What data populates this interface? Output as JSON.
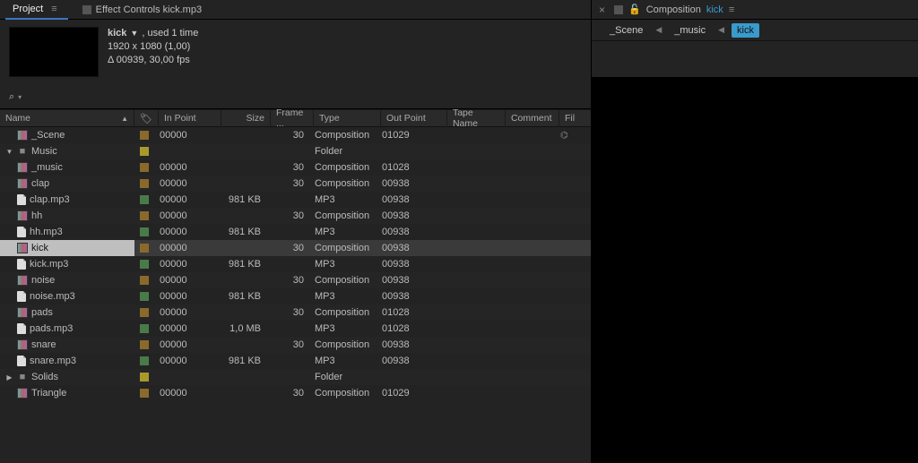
{
  "tabs": {
    "project": "Project",
    "effectControls": "Effect Controls kick.mp3"
  },
  "previewMeta": {
    "name": "kick",
    "used": ", used 1 time",
    "dims": "1920 x 1080 (1,00)",
    "delta": "Δ 00939, 30,00 fps"
  },
  "search": {
    "placeholder": ""
  },
  "columns": {
    "name": "Name",
    "inpoint": "In Point",
    "size": "Size",
    "frame": "Frame ...",
    "type": "Type",
    "outpoint": "Out Point",
    "tape": "Tape Name",
    "comment": "Comment",
    "fil": "Fil"
  },
  "rows": [
    {
      "depth": 0,
      "twisty": "",
      "icon": "comp",
      "name": "_Scene",
      "tagColor": "orange",
      "inpoint": "00000",
      "size": "",
      "frame": "30",
      "type": "Composition",
      "outpoint": "01029",
      "selected": false,
      "flow": true
    },
    {
      "depth": 0,
      "twisty": "▼",
      "icon": "folder",
      "name": "Music",
      "tagColor": "yellow",
      "inpoint": "",
      "size": "",
      "frame": "",
      "type": "Folder",
      "outpoint": "",
      "selected": false
    },
    {
      "depth": 1,
      "twisty": "",
      "icon": "comp",
      "name": "_music",
      "tagColor": "orange",
      "inpoint": "00000",
      "size": "",
      "frame": "30",
      "type": "Composition",
      "outpoint": "01028",
      "selected": false
    },
    {
      "depth": 1,
      "twisty": "",
      "icon": "comp",
      "name": "clap",
      "tagColor": "orange",
      "inpoint": "00000",
      "size": "",
      "frame": "30",
      "type": "Composition",
      "outpoint": "00938",
      "selected": false
    },
    {
      "depth": 1,
      "twisty": "",
      "icon": "file",
      "name": "clap.mp3",
      "tagColor": "green",
      "inpoint": "00000",
      "size": "981 KB",
      "frame": "",
      "type": "MP3",
      "outpoint": "00938",
      "selected": false
    },
    {
      "depth": 1,
      "twisty": "",
      "icon": "comp",
      "name": "hh",
      "tagColor": "orange",
      "inpoint": "00000",
      "size": "",
      "frame": "30",
      "type": "Composition",
      "outpoint": "00938",
      "selected": false
    },
    {
      "depth": 1,
      "twisty": "",
      "icon": "file",
      "name": "hh.mp3",
      "tagColor": "green",
      "inpoint": "00000",
      "size": "981 KB",
      "frame": "",
      "type": "MP3",
      "outpoint": "00938",
      "selected": false
    },
    {
      "depth": 1,
      "twisty": "",
      "icon": "comp",
      "name": "kick",
      "tagColor": "orange",
      "inpoint": "00000",
      "size": "",
      "frame": "30",
      "type": "Composition",
      "outpoint": "00938",
      "selected": true
    },
    {
      "depth": 1,
      "twisty": "",
      "icon": "file",
      "name": "kick.mp3",
      "tagColor": "green",
      "inpoint": "00000",
      "size": "981 KB",
      "frame": "",
      "type": "MP3",
      "outpoint": "00938",
      "selected": false
    },
    {
      "depth": 1,
      "twisty": "",
      "icon": "comp",
      "name": "noise",
      "tagColor": "orange",
      "inpoint": "00000",
      "size": "",
      "frame": "30",
      "type": "Composition",
      "outpoint": "00938",
      "selected": false
    },
    {
      "depth": 1,
      "twisty": "",
      "icon": "file",
      "name": "noise.mp3",
      "tagColor": "green",
      "inpoint": "00000",
      "size": "981 KB",
      "frame": "",
      "type": "MP3",
      "outpoint": "00938",
      "selected": false
    },
    {
      "depth": 1,
      "twisty": "",
      "icon": "comp",
      "name": "pads",
      "tagColor": "orange",
      "inpoint": "00000",
      "size": "",
      "frame": "30",
      "type": "Composition",
      "outpoint": "01028",
      "selected": false
    },
    {
      "depth": 1,
      "twisty": "",
      "icon": "file",
      "name": "pads.mp3",
      "tagColor": "green",
      "inpoint": "00000",
      "size": "1,0 MB",
      "frame": "",
      "type": "MP3",
      "outpoint": "01028",
      "selected": false
    },
    {
      "depth": 1,
      "twisty": "",
      "icon": "comp",
      "name": "snare",
      "tagColor": "orange",
      "inpoint": "00000",
      "size": "",
      "frame": "30",
      "type": "Composition",
      "outpoint": "00938",
      "selected": false
    },
    {
      "depth": 1,
      "twisty": "",
      "icon": "file",
      "name": "snare.mp3",
      "tagColor": "green",
      "inpoint": "00000",
      "size": "981 KB",
      "frame": "",
      "type": "MP3",
      "outpoint": "00938",
      "selected": false
    },
    {
      "depth": 0,
      "twisty": "▶",
      "icon": "folder",
      "name": "Solids",
      "tagColor": "yellow",
      "inpoint": "",
      "size": "",
      "frame": "",
      "type": "Folder",
      "outpoint": "",
      "selected": false
    },
    {
      "depth": 0,
      "twisty": "",
      "icon": "comp",
      "name": "Triangle",
      "tagColor": "orange",
      "inpoint": "00000",
      "size": "",
      "frame": "30",
      "type": "Composition",
      "outpoint": "01029",
      "selected": false
    }
  ],
  "rightPanel": {
    "compLabel": "Composition",
    "compName": "kick",
    "breadcrumb": [
      "_Scene",
      "_music",
      "kick"
    ]
  }
}
